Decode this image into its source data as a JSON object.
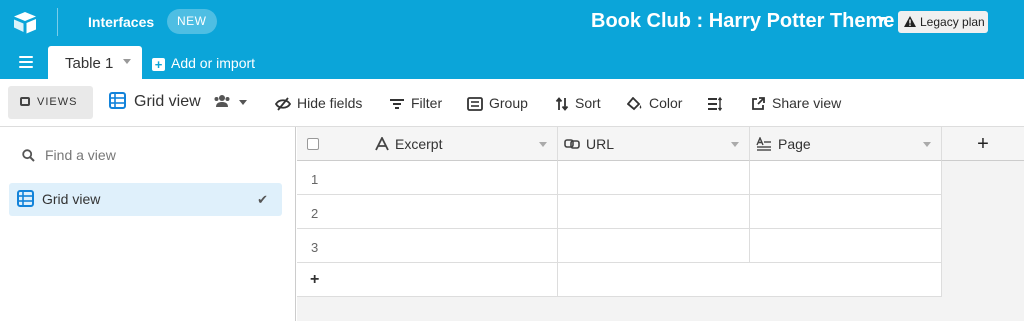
{
  "topbar": {
    "interfaces_label": "Interfaces",
    "new_badge": "NEW",
    "base_title": "Book Club : Harry Potter Theme",
    "legacy_label": "Legacy plan"
  },
  "tabs": {
    "active_table": "Table 1",
    "add_import": "Add or import"
  },
  "toolbar": {
    "views_label": "VIEWS",
    "view_name": "Grid view",
    "hide_fields": "Hide fields",
    "filter": "Filter",
    "group": "Group",
    "sort": "Sort",
    "color": "Color",
    "share_view": "Share view"
  },
  "sidebar": {
    "search_placeholder": "Find a view",
    "views": [
      {
        "label": "Grid view",
        "selected": true
      }
    ]
  },
  "grid": {
    "fields": [
      {
        "name": "Excerpt",
        "type_icon": "text-icon"
      },
      {
        "name": "URL",
        "type_icon": "link-icon"
      },
      {
        "name": "Page",
        "type_icon": "long-text-icon"
      }
    ],
    "rows": [
      "1",
      "2",
      "3"
    ],
    "add_row": "+",
    "add_field": "+"
  },
  "colors": {
    "brand": "#0ba5d9",
    "selected_view_bg": "#dff0fb",
    "grid_icon": "#1283da"
  }
}
